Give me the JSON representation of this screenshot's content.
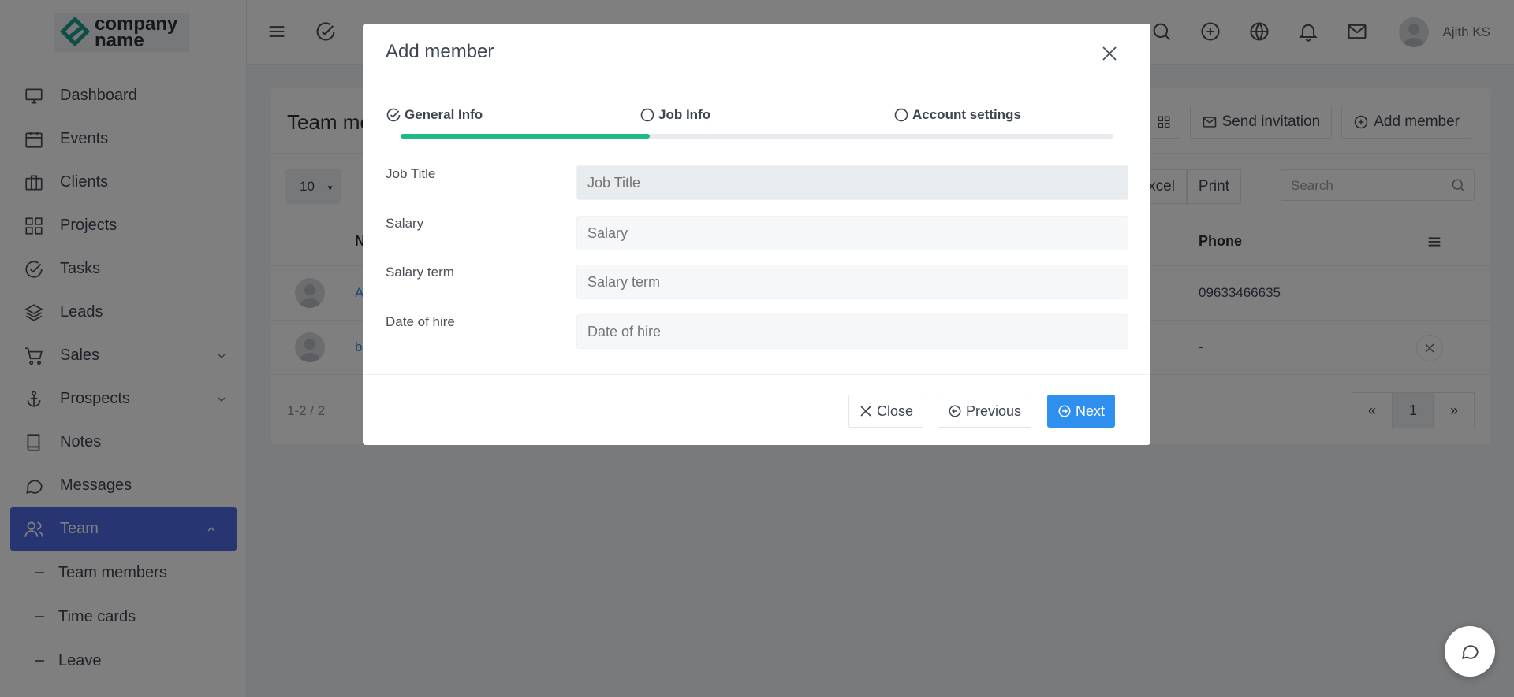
{
  "logo": {
    "text_line1": "company",
    "text_line2": "name"
  },
  "sidebar": {
    "items": [
      {
        "label": "Dashboard",
        "icon": "monitor-icon"
      },
      {
        "label": "Events",
        "icon": "calendar-icon"
      },
      {
        "label": "Clients",
        "icon": "briefcase-icon"
      },
      {
        "label": "Projects",
        "icon": "grid-icon"
      },
      {
        "label": "Tasks",
        "icon": "check-circle-icon"
      },
      {
        "label": "Leads",
        "icon": "layers-icon"
      },
      {
        "label": "Sales",
        "icon": "cart-icon"
      },
      {
        "label": "Prospects",
        "icon": "anchor-icon"
      },
      {
        "label": "Notes",
        "icon": "book-icon"
      },
      {
        "label": "Messages",
        "icon": "message-icon"
      },
      {
        "label": "Team",
        "icon": "users-icon"
      }
    ],
    "sub_items": [
      {
        "label": "Team members"
      },
      {
        "label": "Time cards"
      },
      {
        "label": "Leave"
      }
    ]
  },
  "topbar": {
    "user_name": "Ajith KS"
  },
  "card": {
    "title": "Team me",
    "send_invitation": "Send invitation",
    "add_member": "Add member",
    "page_size": "10",
    "excel": "Excel",
    "print": "Print",
    "search_placeholder": "Search",
    "col_name": "N",
    "col_phone": "Phone",
    "rows": [
      {
        "name": "A",
        "phone": "09633466635"
      },
      {
        "name": "b",
        "phone": "-"
      }
    ],
    "count": "1-2 / 2",
    "page": "1"
  },
  "modal": {
    "title": "Add member",
    "steps": [
      {
        "label": "General Info",
        "state": "done"
      },
      {
        "label": "Job Info",
        "state": "pending"
      },
      {
        "label": "Account settings",
        "state": "pending"
      }
    ],
    "progress": 0.35,
    "fields": [
      {
        "label": "Job Title",
        "placeholder": "Job Title"
      },
      {
        "label": "Salary",
        "placeholder": "Salary"
      },
      {
        "label": "Salary term",
        "placeholder": "Salary term"
      },
      {
        "label": "Date of hire",
        "placeholder": "Date of hire"
      }
    ],
    "close_label": "Close",
    "previous_label": "Previous",
    "next_label": "Next"
  },
  "colors": {
    "accent": "#2f8fee",
    "progress": "#1fb987",
    "sidebar_active": "#4e6ae6"
  }
}
